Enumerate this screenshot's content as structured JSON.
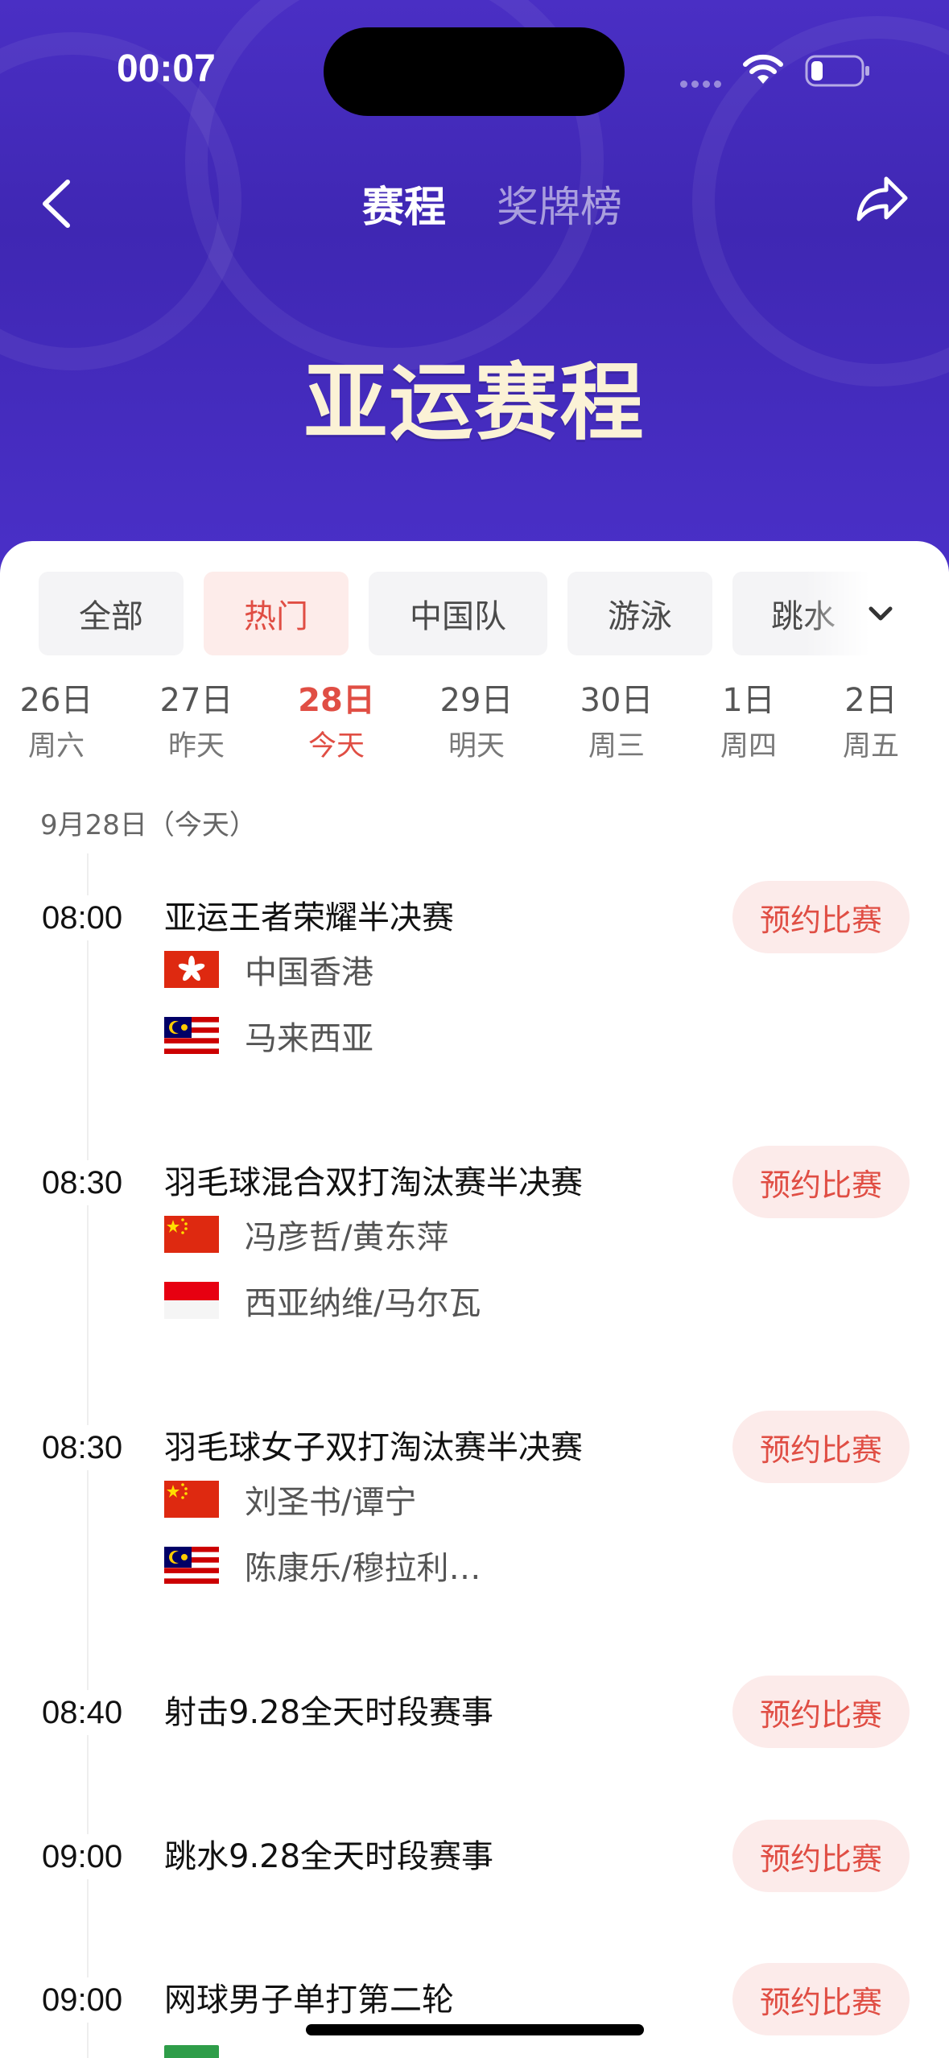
{
  "status_bar": {
    "time": "00:07"
  },
  "nav": {
    "tabs": [
      {
        "label": "赛程"
      },
      {
        "label": "奖牌榜"
      }
    ]
  },
  "page_title": "亚运赛程",
  "filters": [
    {
      "label": "全部"
    },
    {
      "label": "热门"
    },
    {
      "label": "中国队"
    },
    {
      "label": "游泳"
    },
    {
      "label": "跳水"
    }
  ],
  "dates": [
    {
      "day": "26日",
      "week": "周六"
    },
    {
      "day": "27日",
      "week": "昨天"
    },
    {
      "day": "28日",
      "week": "今天"
    },
    {
      "day": "29日",
      "week": "明天"
    },
    {
      "day": "30日",
      "week": "周三"
    },
    {
      "day": "1日",
      "week": "周四"
    },
    {
      "day": "2日",
      "week": "周五"
    }
  ],
  "day_heading": "9月28日（今天）",
  "reserve_label": "预约比赛",
  "events": [
    {
      "time": "08:00",
      "title": "亚运王者荣耀半决赛",
      "teams": [
        {
          "name": "中国香港",
          "flag": "hong-kong"
        },
        {
          "name": "马来西亚",
          "flag": "malaysia"
        }
      ]
    },
    {
      "time": "08:30",
      "title": "羽毛球混合双打淘汰赛半决赛",
      "teams": [
        {
          "name": "冯彦哲/黄东萍",
          "flag": "china"
        },
        {
          "name": "西亚纳维/马尔瓦",
          "flag": "indonesia"
        }
      ]
    },
    {
      "time": "08:30",
      "title": "羽毛球女子双打淘汰赛半决赛",
      "teams": [
        {
          "name": "刘圣书/谭宁",
          "flag": "china"
        },
        {
          "name": "陈康乐/穆拉利…",
          "flag": "malaysia"
        }
      ]
    },
    {
      "time": "08:40",
      "title": "射击9.28全天时段赛事"
    },
    {
      "time": "09:00",
      "title": "跳水9.28全天时段赛事"
    },
    {
      "time": "09:00",
      "title": "网球男子单打第二轮"
    }
  ],
  "colors": {
    "header": "#4a2fc4",
    "accent": "#e04e44",
    "accent_bg": "#fcebea",
    "title_text": "#fbf2d6"
  }
}
